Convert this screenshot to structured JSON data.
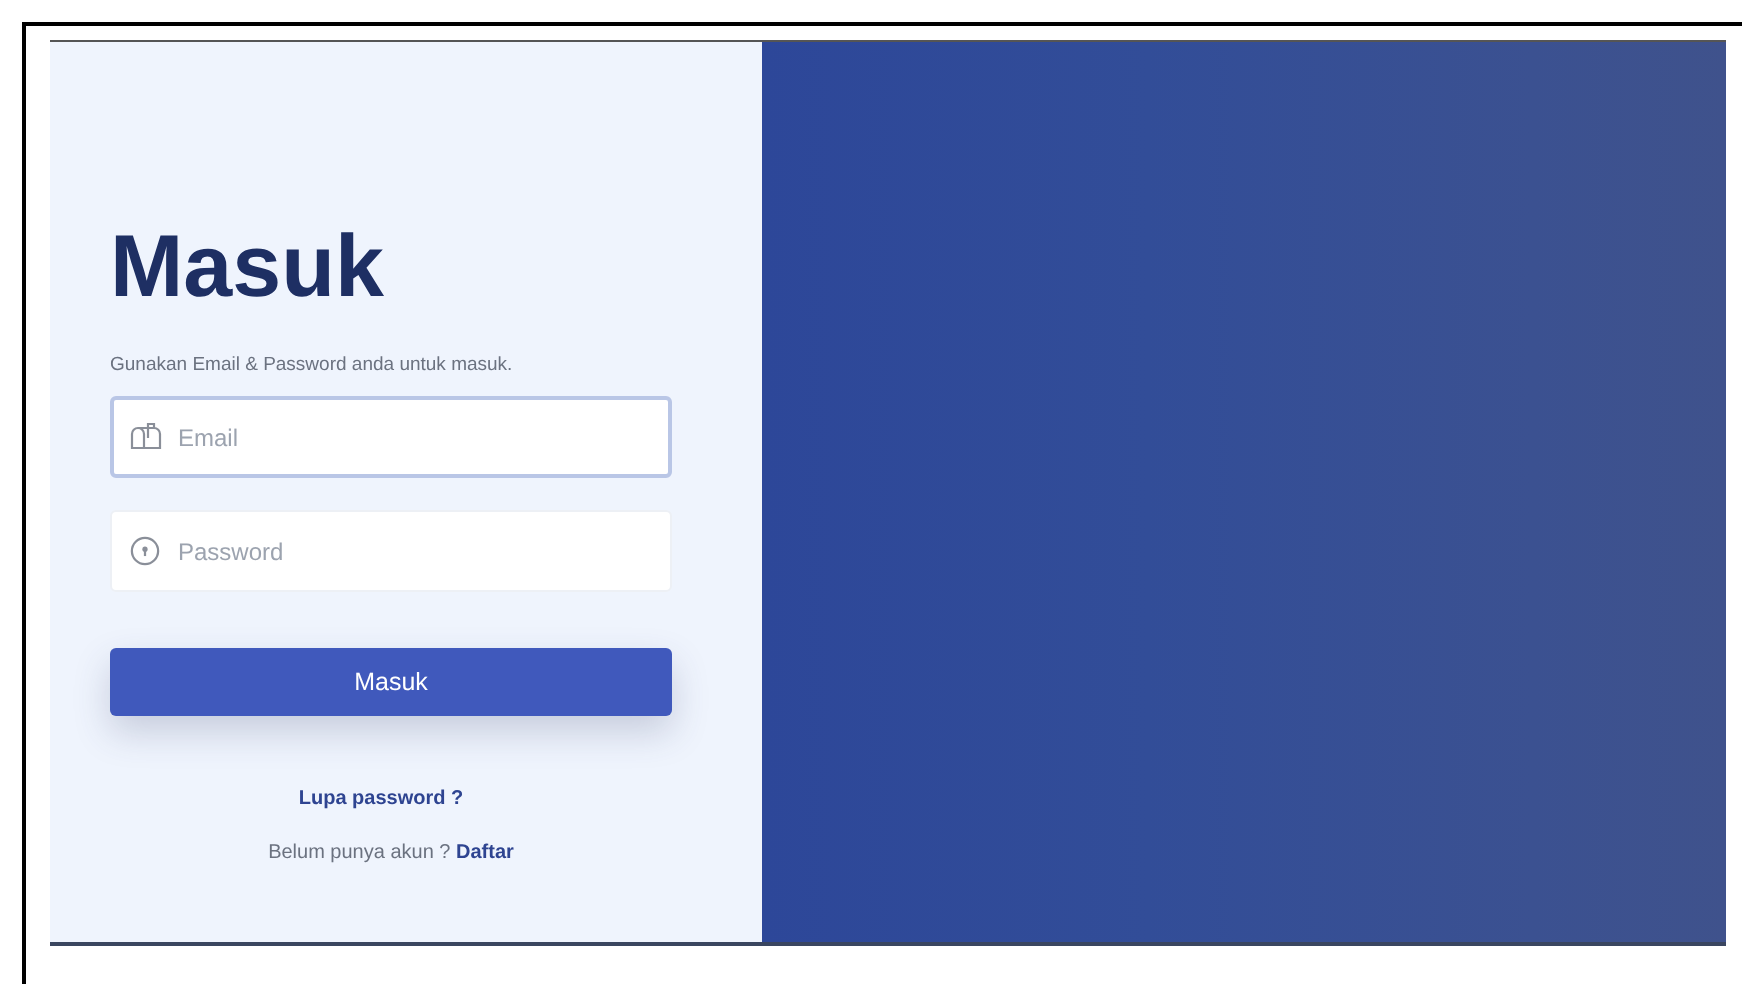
{
  "login": {
    "title": "Masuk",
    "subtitle": "Gunakan Email & Password anda untuk masuk.",
    "fields": [
      {
        "kind": "email",
        "placeholder": "Email",
        "focused": true
      },
      {
        "kind": "password",
        "placeholder": "Password",
        "focused": false
      }
    ],
    "submit": "Masuk",
    "forgot_link": "Lupa password ?",
    "signup_prompt": "Belum punya akun ?",
    "signup_link": "Daftar"
  }
}
